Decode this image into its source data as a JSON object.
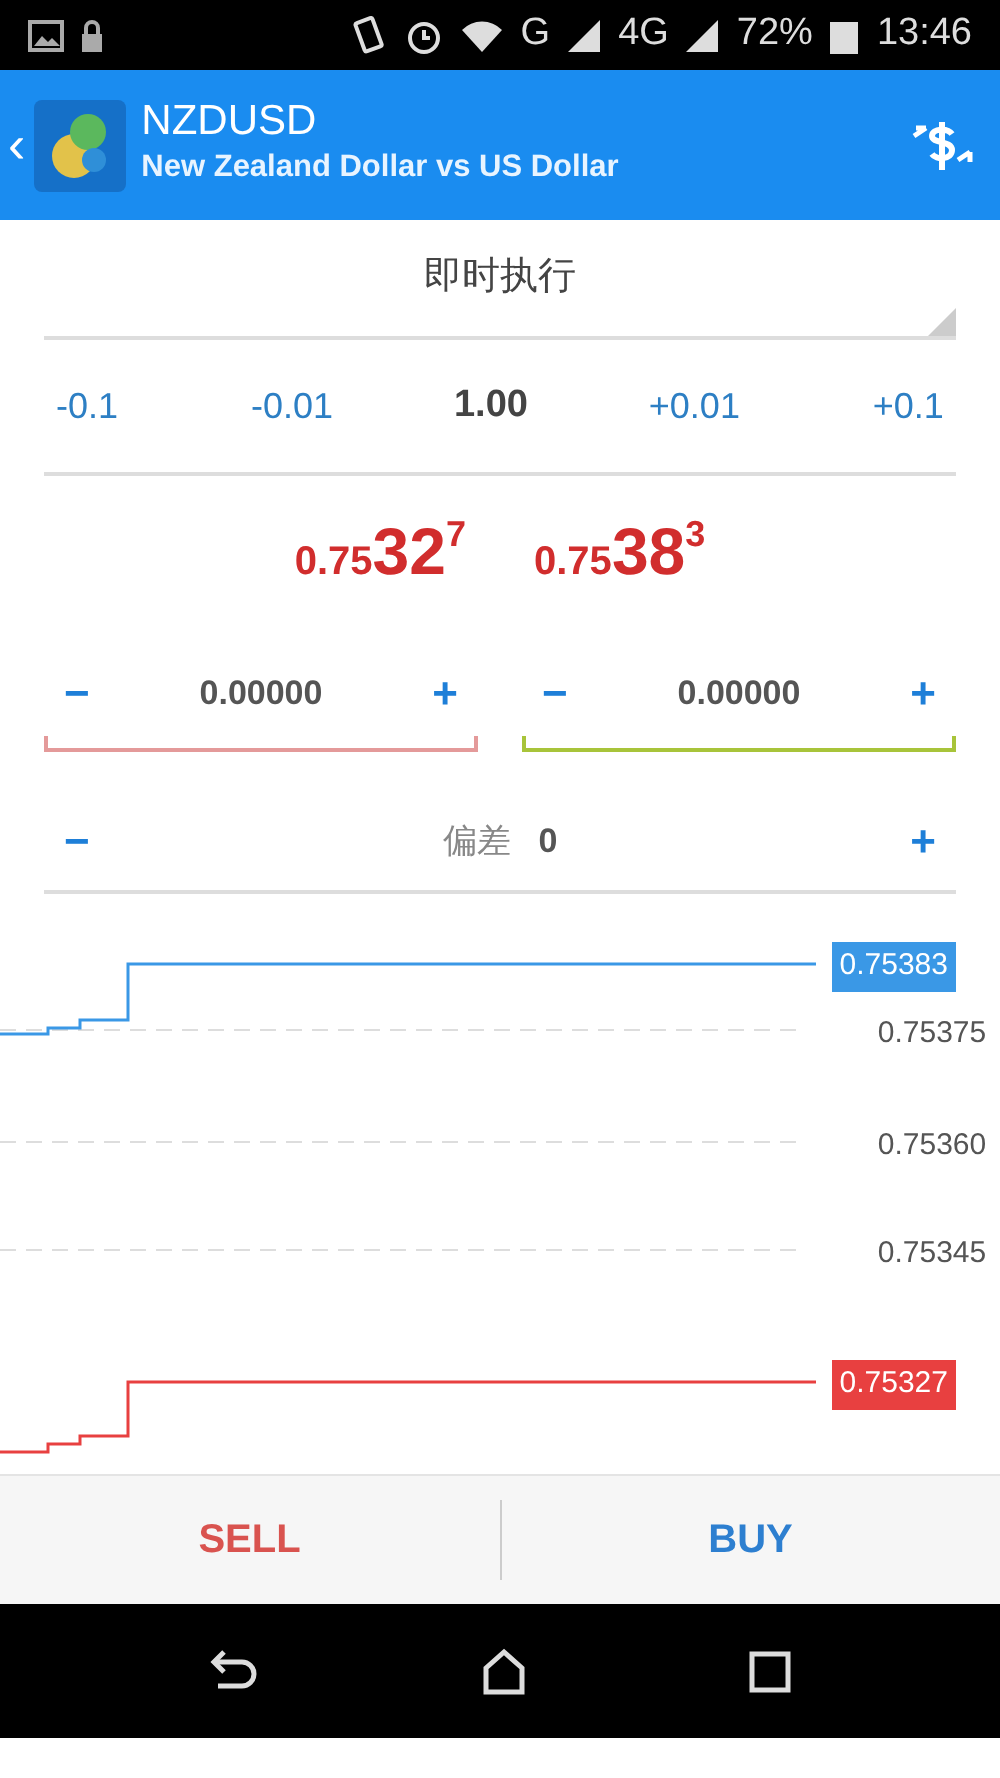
{
  "status_bar": {
    "network": "G",
    "network_2": "4G",
    "battery": "72%",
    "time": "13:46"
  },
  "header": {
    "back": "‹",
    "symbol": "NZDUSD",
    "description": "New Zealand Dollar vs US Dollar"
  },
  "execution": {
    "label": "即时执行"
  },
  "volume": {
    "down": [
      "-0.1",
      "-0.01"
    ],
    "value": "1.00",
    "up": [
      "+0.01",
      "+0.1"
    ]
  },
  "prices": [
    {
      "prefix": "0.75",
      "big": "32",
      "small": "7"
    },
    {
      "prefix": "0.75",
      "big": "38",
      "small": "3"
    }
  ],
  "stops": [
    {
      "kind": "stop_loss",
      "minus": "−",
      "value": "0.00000",
      "plus": "+"
    },
    {
      "kind": "take_profit",
      "minus": "−",
      "value": "0.00000",
      "plus": "+"
    }
  ],
  "deviation": {
    "minus": "−",
    "label": "偏差",
    "value": "0",
    "plus": "+"
  },
  "chart": {
    "axis_labels": [
      "0.75375",
      "0.75360",
      "0.75345"
    ],
    "price_tags": [
      {
        "label": "0.75383",
        "color": "#3a98e6"
      },
      {
        "label": "0.75327",
        "color": "#e84040"
      }
    ]
  },
  "actions": [
    {
      "kind": "sell",
      "label": "SELL"
    },
    {
      "kind": "buy",
      "label": "BUY"
    }
  ]
}
